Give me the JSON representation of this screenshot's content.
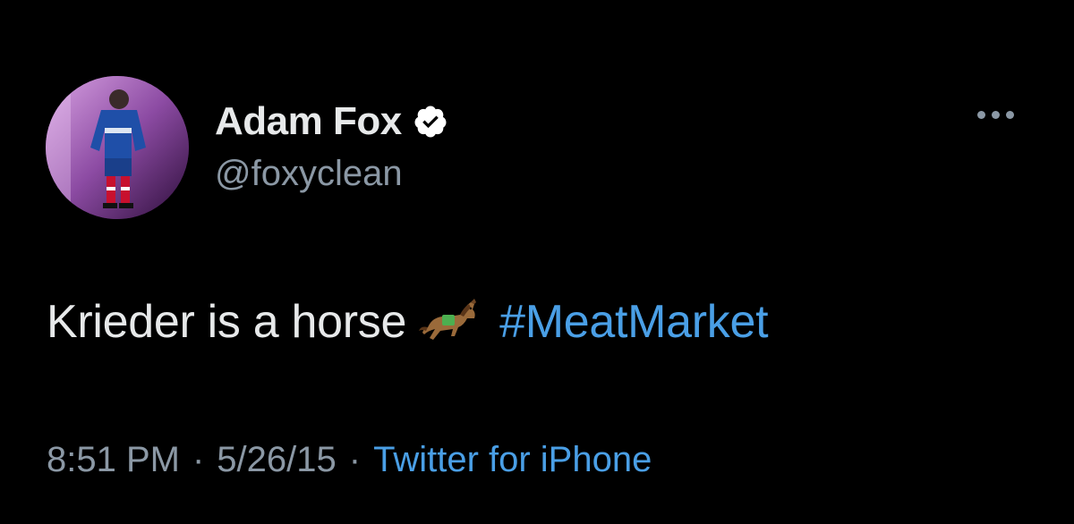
{
  "tweet": {
    "author": {
      "display_name": "Adam Fox",
      "handle": "@foxyclean",
      "verified": true
    },
    "text_before": "Krieder is a horse",
    "emoji": "horse-racing-emoji",
    "hashtag": "#MeatMarket",
    "meta": {
      "time": "8:51 PM",
      "separator": "·",
      "date": "5/26/15",
      "source": "Twitter for iPhone"
    }
  },
  "colors": {
    "background": "#000000",
    "primary_text": "#e7e9ea",
    "secondary_text": "#8b98a5",
    "link": "#4a9fe6"
  }
}
